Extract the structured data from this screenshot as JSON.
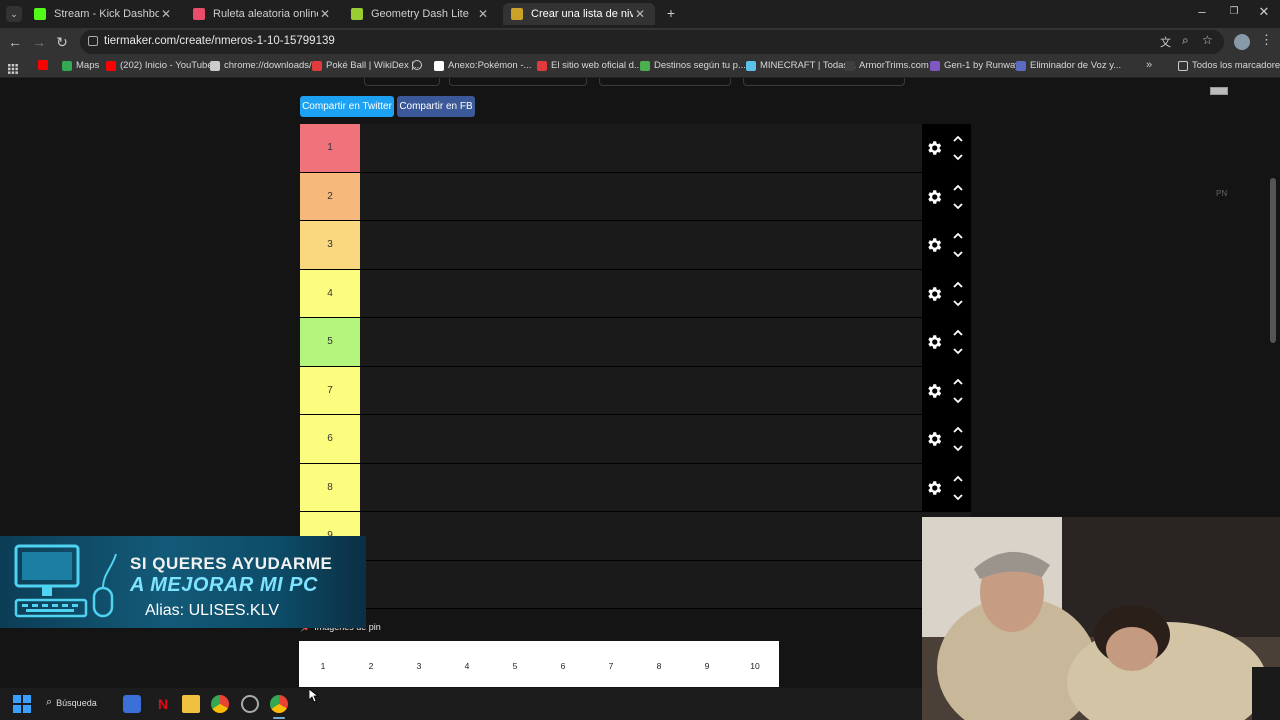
{
  "browser": {
    "tabs": [
      {
        "title": "Stream - Kick Dashboard",
        "active": false,
        "favicon_color": "#53fc18"
      },
      {
        "title": "Ruleta aleatoria online – ruleta",
        "active": false,
        "favicon_color": "#e94d6a"
      },
      {
        "title": "Geometry Dash Lite",
        "active": false,
        "favicon_color": "#9acd32"
      },
      {
        "title": "Crear una lista de niveles de Nú",
        "active": true,
        "favicon_color": "#c9a227"
      }
    ],
    "new_tab_icon": "plus-icon",
    "url": "tiermaker.com/create/nmeros-1-10-15799139",
    "bookmarks": [
      {
        "label": "",
        "icon": "youtube-icon",
        "color": "#ff0000"
      },
      {
        "label": "Maps",
        "icon": "maps-icon",
        "color": "#34a853"
      },
      {
        "label": "(202) Inicio - YouTube",
        "icon": "youtube-icon",
        "color": "#ff0000"
      },
      {
        "label": "chrome://downloads/",
        "icon": "download-icon",
        "color": "#cccccc"
      },
      {
        "label": "Poké Ball | WikiDex |...",
        "icon": "pokeball-icon",
        "color": "#e03a3a"
      },
      {
        "label": "",
        "icon": "globe-icon",
        "color": "#cccccc"
      },
      {
        "label": "Anexo:Pokémon -...",
        "icon": "wikipedia-icon",
        "color": "#ffffff"
      },
      {
        "label": "El sitio web oficial d...",
        "icon": "pokeball-icon",
        "color": "#e03a3a"
      },
      {
        "label": "Destinos según tu p...",
        "icon": "triangle-icon",
        "color": "#4caf50"
      },
      {
        "label": "MINECRAFT | Todas...",
        "icon": "diamond-icon",
        "color": "#5bc0eb"
      },
      {
        "label": "ArmorTrims.com",
        "icon": "armor-icon",
        "color": "#3f3f3f"
      },
      {
        "label": "Gen-1 by Runway",
        "icon": "runway-icon",
        "color": "#7e57c2"
      },
      {
        "label": "Eliminador de Voz y...",
        "icon": "v-icon",
        "color": "#5c6bc0"
      }
    ],
    "all_bookmarks": "Todos los marcadores"
  },
  "page": {
    "share_twitter": "Compartir en Twitter",
    "share_fb": "Compartir en FB",
    "tiers": [
      {
        "label": "1",
        "color": "#f0727a"
      },
      {
        "label": "2",
        "color": "#f7b97b"
      },
      {
        "label": "3",
        "color": "#fad880"
      },
      {
        "label": "4",
        "color": "#fcfd7f"
      },
      {
        "label": "5",
        "color": "#b4f57d"
      },
      {
        "label": "7",
        "color": "#fcfd7f"
      },
      {
        "label": "6",
        "color": "#fcfd7f"
      },
      {
        "label": "8",
        "color": "#fcfd7f"
      },
      {
        "label": "9",
        "color": "#fcfd7f"
      },
      {
        "label": "",
        "color": "#1a1a1a"
      }
    ],
    "side_text": "PN",
    "pool_label": "Imágenes de pin",
    "pool_items": [
      "1",
      "2",
      "3",
      "4",
      "5",
      "6",
      "7",
      "8",
      "9",
      "10"
    ]
  },
  "banner": {
    "line1": "SI QUERES AYUDARME",
    "line2": "A MEJORAR MI PC",
    "line3": "Alias: ULISES.KLV"
  },
  "taskbar": {
    "search_label": "Búsqueda"
  }
}
